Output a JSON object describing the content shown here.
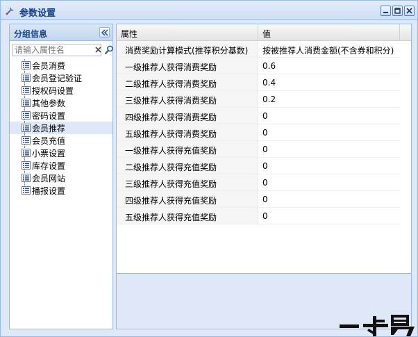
{
  "window": {
    "title": "参数设置"
  },
  "left_panel": {
    "header": "分组信息",
    "search_placeholder": "请输入属性名",
    "items": [
      {
        "label": "会员消费",
        "selected": false
      },
      {
        "label": "会员登记验证",
        "selected": false
      },
      {
        "label": "授权码设置",
        "selected": false
      },
      {
        "label": "其他参数",
        "selected": false
      },
      {
        "label": "密码设置",
        "selected": false
      },
      {
        "label": "会员推荐",
        "selected": true
      },
      {
        "label": "会员充值",
        "selected": false
      },
      {
        "label": "小票设置",
        "selected": false
      },
      {
        "label": "库存设置",
        "selected": false
      },
      {
        "label": "会员网站",
        "selected": false
      },
      {
        "label": "播报设置",
        "selected": false
      }
    ]
  },
  "grid": {
    "columns": [
      "属性",
      "值"
    ],
    "rows": [
      {
        "prop": "消费奖励计算模式(推荐积分基数)",
        "value": "按被推荐人消费金额(不含券和积分)"
      },
      {
        "prop": "一级推荐人获得消费奖励",
        "value": "0.6"
      },
      {
        "prop": "二级推荐人获得消费奖励",
        "value": "0.4"
      },
      {
        "prop": "三级推荐人获得消费奖励",
        "value": "0.2"
      },
      {
        "prop": "四级推荐人获得消费奖励",
        "value": "0"
      },
      {
        "prop": "五级推荐人获得消费奖励",
        "value": "0"
      },
      {
        "prop": "一级推荐人获得充值奖励",
        "value": "0"
      },
      {
        "prop": "二级推荐人获得充值奖励",
        "value": "0"
      },
      {
        "prop": "三级推荐人获得充值奖励",
        "value": "0"
      },
      {
        "prop": "四级推荐人获得充值奖励",
        "value": "0"
      },
      {
        "prop": "五级推荐人获得充值奖励",
        "value": "0"
      }
    ]
  },
  "watermark": {
    "text": "一卡易"
  },
  "icons": {
    "title": "settings-wrench-icon",
    "minimize": "minimize-icon",
    "maximize": "maximize-icon",
    "close": "close-icon",
    "collapse": "double-chevron-left-icon",
    "clear": "clear-x-icon",
    "search": "magnifier-icon",
    "tree_leaf": "list-document-icon"
  },
  "colors": {
    "title_text": "#15428b",
    "panel_border": "#99bbe8",
    "panel_bg": "#dfe8f6",
    "selected_row": "#dfe8f6"
  }
}
